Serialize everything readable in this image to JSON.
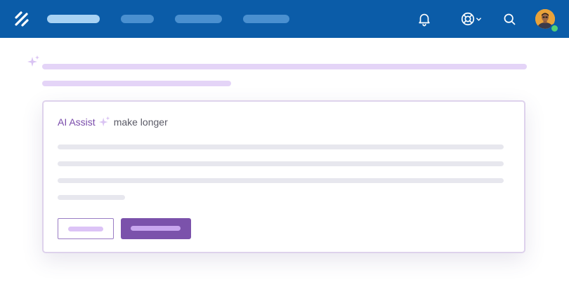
{
  "colors": {
    "nav_background": "#0b5ca8",
    "nav_pill_active": "#a8d2f3",
    "nav_pill": "#4a90d0",
    "accent_purple": "#7b52ab",
    "skeleton_purple": "#e4d4f7",
    "skeleton_gray": "#e7e7ee",
    "presence_online": "#4fcf76"
  },
  "header": {
    "logo_icon": "logo-slashes-icon",
    "icons": [
      "bell-icon",
      "lifebuoy-icon",
      "chevron-down-icon",
      "search-icon"
    ],
    "avatar_status": "online"
  },
  "card": {
    "assist_label": "AI Assist",
    "assist_icon": "sparkle-icon",
    "mode_text": "make longer"
  }
}
